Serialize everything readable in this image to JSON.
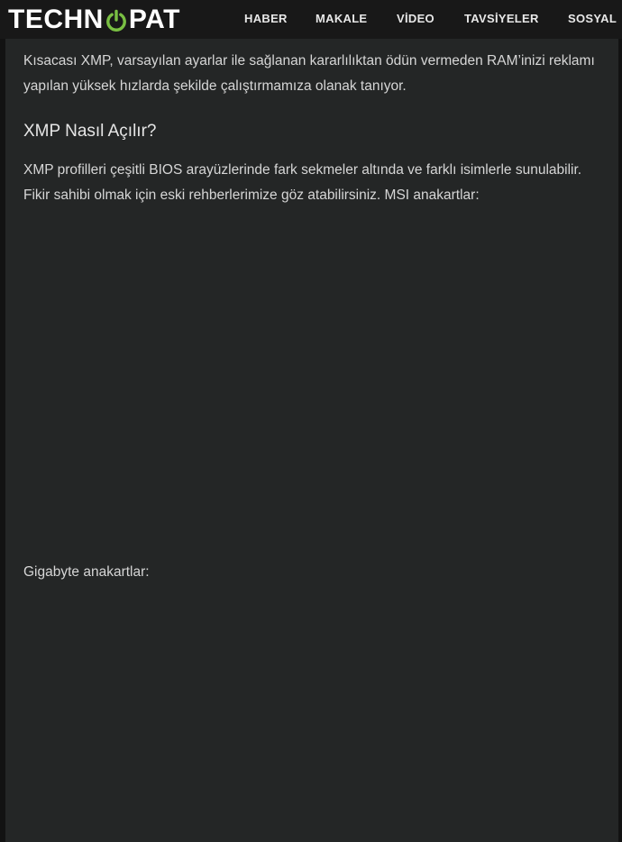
{
  "header": {
    "logo": {
      "text_before": "TECHN",
      "text_after": "PAT",
      "icon": "power-icon",
      "accent_color": "#7ac043"
    },
    "nav": [
      {
        "label": "HABER"
      },
      {
        "label": "MAKALE"
      },
      {
        "label": "VİDEO"
      },
      {
        "label": "TAVSİYELER"
      },
      {
        "label": "SOSYAL"
      }
    ]
  },
  "article": {
    "intro": "Kısacası XMP, varsayılan ayarlar ile sağlanan kararlılıktan ödün vermeden RAM’inizi reklamı yapılan yüksek hızlarda şekilde çalıştırmamıza olanak tanıyor.",
    "section_heading": "XMP Nasıl Açılır?",
    "section_text": "XMP profilleri çeşitli BIOS arayüzlerinde fark sekmeler altında ve farklı isimlerle sunulabilir. Fikir sahibi olmak için eski rehberlerimize göz atabilirsiniz. MSI anakartlar:",
    "gigabyte_label": "Gigabyte anakartlar:"
  },
  "colors": {
    "page_background": "#121212",
    "header_background": "#181818",
    "content_background": "#242626",
    "text": "#d6d6d6"
  }
}
